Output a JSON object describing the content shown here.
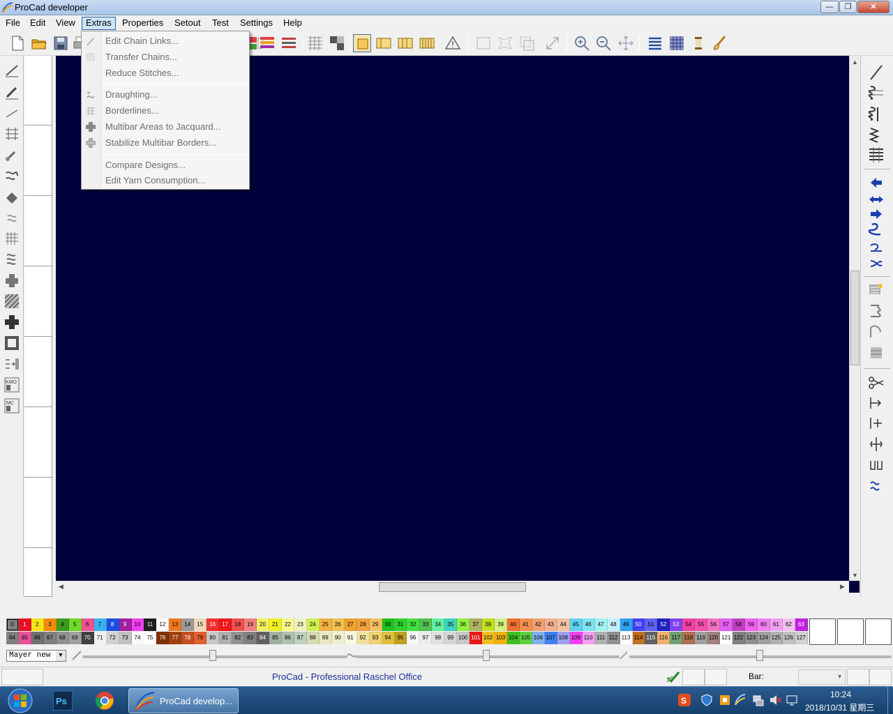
{
  "window": {
    "title": "ProCad developer",
    "controls": {
      "minimize": "—",
      "maximize": "❐",
      "close": "✕"
    }
  },
  "menubar": {
    "items": [
      {
        "label": "File"
      },
      {
        "label": "Edit"
      },
      {
        "label": "View"
      },
      {
        "label": "Extras"
      },
      {
        "label": "Properties"
      },
      {
        "label": "Setout"
      },
      {
        "label": "Test"
      },
      {
        "label": "Settings"
      },
      {
        "label": "Help"
      }
    ]
  },
  "extras_menu": {
    "items": [
      {
        "label": "Edit Chain Links...",
        "icon": "pencil-icon",
        "enabled": false
      },
      {
        "label": "Transfer Chains...",
        "icon": "transfer-icon",
        "enabled": false
      },
      {
        "label": "Reduce Stitches...",
        "icon": "",
        "enabled": false
      },
      {
        "label": "Draughting...",
        "icon": "draughting-icon",
        "enabled": false
      },
      {
        "label": "Borderlines...",
        "icon": "borderlines-icon",
        "enabled": false
      },
      {
        "label": "Multibar Areas to Jacquard...",
        "icon": "jacquard-icon",
        "enabled": false
      },
      {
        "label": "Stabilize Multibar Borders...",
        "icon": "stabilize-icon",
        "enabled": false
      },
      {
        "label": "Compare Designs...",
        "icon": "",
        "enabled": false
      },
      {
        "label": "Edit Yarn Consumption...",
        "icon": "",
        "enabled": false
      }
    ]
  },
  "palette": {
    "top_row": [
      "0",
      "1",
      "2",
      "3",
      "4",
      "5",
      "6",
      "7",
      "8",
      "9",
      "10",
      "11",
      "12",
      "13",
      "14",
      "15",
      "16",
      "17",
      "18",
      "19",
      "20",
      "21",
      "22",
      "23",
      "24",
      "25",
      "26",
      "27",
      "28",
      "29",
      "30",
      "31",
      "32",
      "33",
      "34",
      "35",
      "36",
      "37",
      "38",
      "39",
      "40",
      "41",
      "42",
      "43",
      "44",
      "45",
      "46",
      "47",
      "48",
      "49",
      "50",
      "51",
      "52",
      "53",
      "54",
      "55",
      "56",
      "57",
      "58",
      "59",
      "60",
      "61",
      "62",
      "63"
    ],
    "bottom_row": [
      "64",
      "65",
      "66",
      "67",
      "68",
      "69",
      "70",
      "71",
      "72",
      "73",
      "74",
      "75",
      "76",
      "77",
      "78",
      "79",
      "80",
      "81",
      "82",
      "83",
      "84",
      "85",
      "86",
      "87",
      "88",
      "89",
      "90",
      "91",
      "92",
      "93",
      "94",
      "95",
      "96",
      "97",
      "98",
      "99",
      "100",
      "101",
      "102",
      "103",
      "104",
      "105",
      "106",
      "107",
      "108",
      "109",
      "110",
      "111",
      "112",
      "113",
      "114",
      "115",
      "116",
      "117",
      "118",
      "119",
      "120",
      "121",
      "122",
      "123",
      "124",
      "125",
      "126",
      "127"
    ],
    "top_colors": [
      "#808080",
      "#e81123",
      "#f7e31c",
      "#f08a0a",
      "#3c9a1c",
      "#6fd92a",
      "#f05090",
      "#3ab0f0",
      "#1c4fe0",
      "#a020a0",
      "#f040f0",
      "#202020",
      "#ffffff",
      "#f07820",
      "#9a9a9a",
      "#f0d8b8",
      "#f03030",
      "#f01818",
      "#f05050",
      "#f08080",
      "#f0f060",
      "#f0f020",
      "#f8f890",
      "#f0f0c0",
      "#d0f050",
      "#f0b040",
      "#f0c050",
      "#f0a030",
      "#f0a040",
      "#f0c060",
      "#20c020",
      "#30d030",
      "#40e040",
      "#50c050",
      "#60f0a0",
      "#40d0c0",
      "#90f040",
      "#b0b060",
      "#c0e020",
      "#d0f080",
      "#f07030",
      "#f09050",
      "#f0a070",
      "#f0b090",
      "#f0c0a0",
      "#60d0f0",
      "#80e0f0",
      "#a0f0f0",
      "#c0f0ff",
      "#30a0f0",
      "#4040f0",
      "#6060f0",
      "#2020c0",
      "#8040f0",
      "#f040a0",
      "#f050b0",
      "#f070c0",
      "#e060f0",
      "#c040c0",
      "#f060f0",
      "#f080f0",
      "#f0a0f0",
      "#f0c0f0",
      "#c020e0"
    ],
    "bottom_colors": [
      "#808080",
      "#e8509a",
      "#707070",
      "#808080",
      "#909090",
      "#a0a0a0",
      "#404040",
      "#f0f0f0",
      "#d0d0d0",
      "#c0c0c0",
      "#f8f8f8",
      "#ffffff",
      "#803000",
      "#a04010",
      "#c05020",
      "#e06030",
      "#c8c8c8",
      "#b0b0b0",
      "#909090",
      "#808080",
      "#606060",
      "#a0b0a0",
      "#b0c0b0",
      "#c0d0c0",
      "#d8d8b0",
      "#e8e8c0",
      "#f0f0d0",
      "#f8f8e0",
      "#f0e0a0",
      "#f0d070",
      "#e0c040",
      "#c0a020",
      "#f8f8f8",
      "#ececec",
      "#e0e0e0",
      "#d4d4d4",
      "#c8c8c8",
      "#e81818",
      "#f0c020",
      "#f0b010",
      "#40c020",
      "#60d040",
      "#80b0f0",
      "#4080f0",
      "#a0a0f0",
      "#f040f0",
      "#f0a0f0",
      "#b0b0b0",
      "#909090",
      "#ffffff",
      "#c07020",
      "#606060",
      "#f0b070",
      "#70a070",
      "#b07050",
      "#a0a0a0",
      "#a08080",
      "#ffffff",
      "#808080",
      "#909090",
      "#a0a0a0",
      "#b0b0b0",
      "#c0c0c0",
      "#d0d0d0"
    ]
  },
  "bottom": {
    "layer_select": "Mayer new",
    "layer_dropdown_icon": "▼"
  },
  "statusbar": {
    "text": "ProCad - Professional Raschel Office",
    "bar_label": "Bar:"
  },
  "taskbar": {
    "task_label": "ProCad develop...",
    "clock_time": "10:24",
    "clock_date": "2018/10/31 星期三"
  },
  "colors": {
    "canvas": "#00003c",
    "status_text": "#1c2f94",
    "menu_active": "#cce4f7"
  }
}
